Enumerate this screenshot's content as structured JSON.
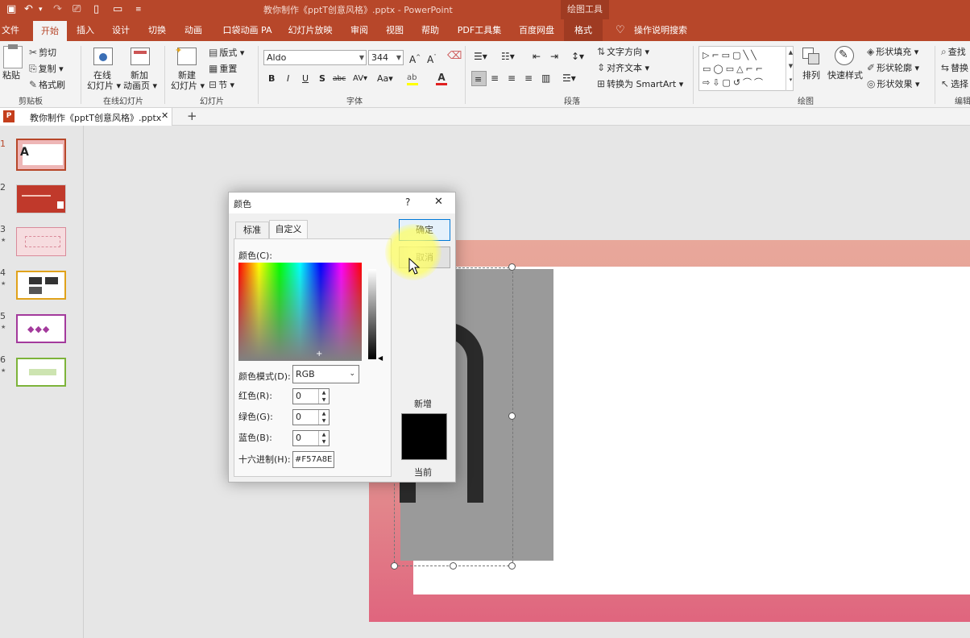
{
  "titlebar": {
    "title": "教你制作《pptT创意风格》.pptx - PowerPoint",
    "context_title": "绘图工具",
    "qat_icons": [
      "save-icon",
      "undo-icon",
      "redo-icon",
      "present-icon",
      "new-icon",
      "open-icon",
      "customize-icon"
    ]
  },
  "tabs": {
    "items": [
      "文件",
      "开始",
      "插入",
      "设计",
      "切换",
      "动画",
      "口袋动画 PA",
      "幻灯片放映",
      "审阅",
      "视图",
      "帮助",
      "PDF工具集",
      "百度网盘",
      "格式"
    ],
    "active": "开始",
    "search": "操作说明搜索"
  },
  "ribbon": {
    "clipboard": {
      "paste": "粘贴",
      "cut": "剪切",
      "copy": "复制",
      "format_painter": "格式刷",
      "label": "剪贴板"
    },
    "online": {
      "online_slide": "在线",
      "online_slide2": "幻灯片",
      "new_anim": "新加",
      "new_anim2": "动画页",
      "label": "在线幻灯片"
    },
    "slides": {
      "new_slide": "新建",
      "new_slide2": "幻灯片",
      "layout": "版式",
      "reset": "重置",
      "section": "节",
      "label": "幻灯片"
    },
    "font": {
      "name": "Aldo",
      "size": "344",
      "bold": "B",
      "italic": "I",
      "underline": "U",
      "shadow": "S",
      "strike": "abc",
      "spacing": "AV",
      "case": "Aa",
      "label": "字体"
    },
    "paragraph": {
      "text_direction": "文字方向",
      "align_text": "对齐文本",
      "smartart": "转换为 SmartArt",
      "label": "段落"
    },
    "drawing": {
      "arrange": "排列",
      "quick_styles": "快速样式",
      "fill": "形状填充",
      "outline": "形状轮廓",
      "effects": "形状效果",
      "label": "绘图"
    },
    "editing": {
      "find": "查找",
      "replace": "替换",
      "select": "选择",
      "label": "编辑"
    }
  },
  "doc_tab": {
    "name": "教你制作《pptT创意风格》.pptx"
  },
  "thumbs": {
    "numbers": [
      "1",
      "2",
      "3",
      "4",
      "5",
      "6"
    ],
    "star": "★",
    "letter": "A",
    "accent_colors": [
      "#b7472a",
      "#c0392b",
      "#d98b9a",
      "#e0a21b",
      "#a33a9c",
      "#7db33a"
    ]
  },
  "dialog": {
    "title": "颜色",
    "help": "?",
    "close": "✕",
    "tabs": [
      "标准",
      "自定义"
    ],
    "active_tab": "自定义",
    "ok": "确定",
    "cancel": "取消",
    "colors_label": "颜色(C):",
    "mode_label": "颜色模式(D):",
    "mode_value": "RGB",
    "red_label": "红色(R):",
    "red_value": "0",
    "green_label": "绿色(G):",
    "green_value": "0",
    "blue_label": "蓝色(B):",
    "blue_value": "0",
    "hex_label": "十六进制(H):",
    "hex_value": "#F57A8E",
    "new_label": "新增",
    "current_label": "当前",
    "new_color": "#000000"
  },
  "colors": {
    "brand": "#b7472a",
    "frame_start": "#e8a79a",
    "frame_end": "#e0657e"
  }
}
